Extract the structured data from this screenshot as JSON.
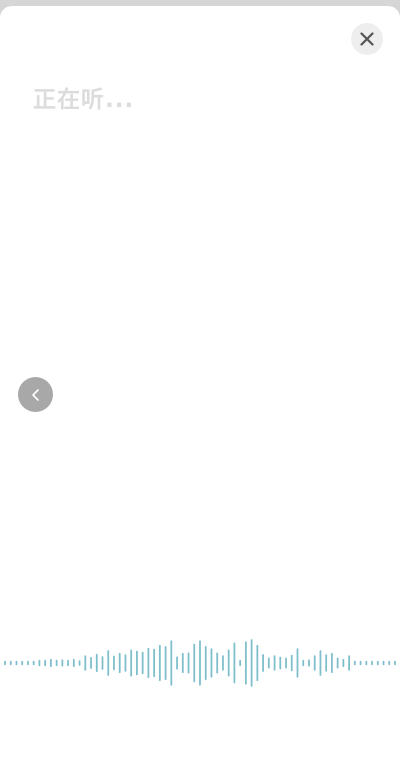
{
  "window": {
    "title": ""
  },
  "header": {
    "close_icon": "close-icon"
  },
  "status": {
    "text": "正在听..."
  },
  "sidebar": {
    "back_icon": "chevron-left-icon"
  },
  "colors": {
    "wave": "#7fbfcc",
    "status_text": "#dcdcdc",
    "close_bg": "#eeeeee",
    "back_bg": "#a8a8a8"
  },
  "waveform": {
    "levels": [
      0.06,
      0.06,
      0.06,
      0.06,
      0.06,
      0.06,
      0.1,
      0.1,
      0.14,
      0.1,
      0.12,
      0.1,
      0.14,
      0.08,
      0.3,
      0.22,
      0.36,
      0.26,
      0.52,
      0.28,
      0.4,
      0.34,
      0.55,
      0.5,
      0.45,
      0.62,
      0.58,
      0.75,
      0.7,
      0.95,
      0.25,
      0.4,
      0.42,
      0.8,
      0.95,
      0.7,
      0.6,
      0.42,
      0.3,
      0.55,
      0.85,
      0.1,
      0.9,
      1.0,
      0.75,
      0.35,
      0.2,
      0.3,
      0.24,
      0.2,
      0.32,
      0.6,
      0.1,
      0.12,
      0.3,
      0.52,
      0.34,
      0.4,
      0.2,
      0.14,
      0.3,
      0.06,
      0.06,
      0.06,
      0.06,
      0.06,
      0.06,
      0.06,
      0.06
    ]
  }
}
